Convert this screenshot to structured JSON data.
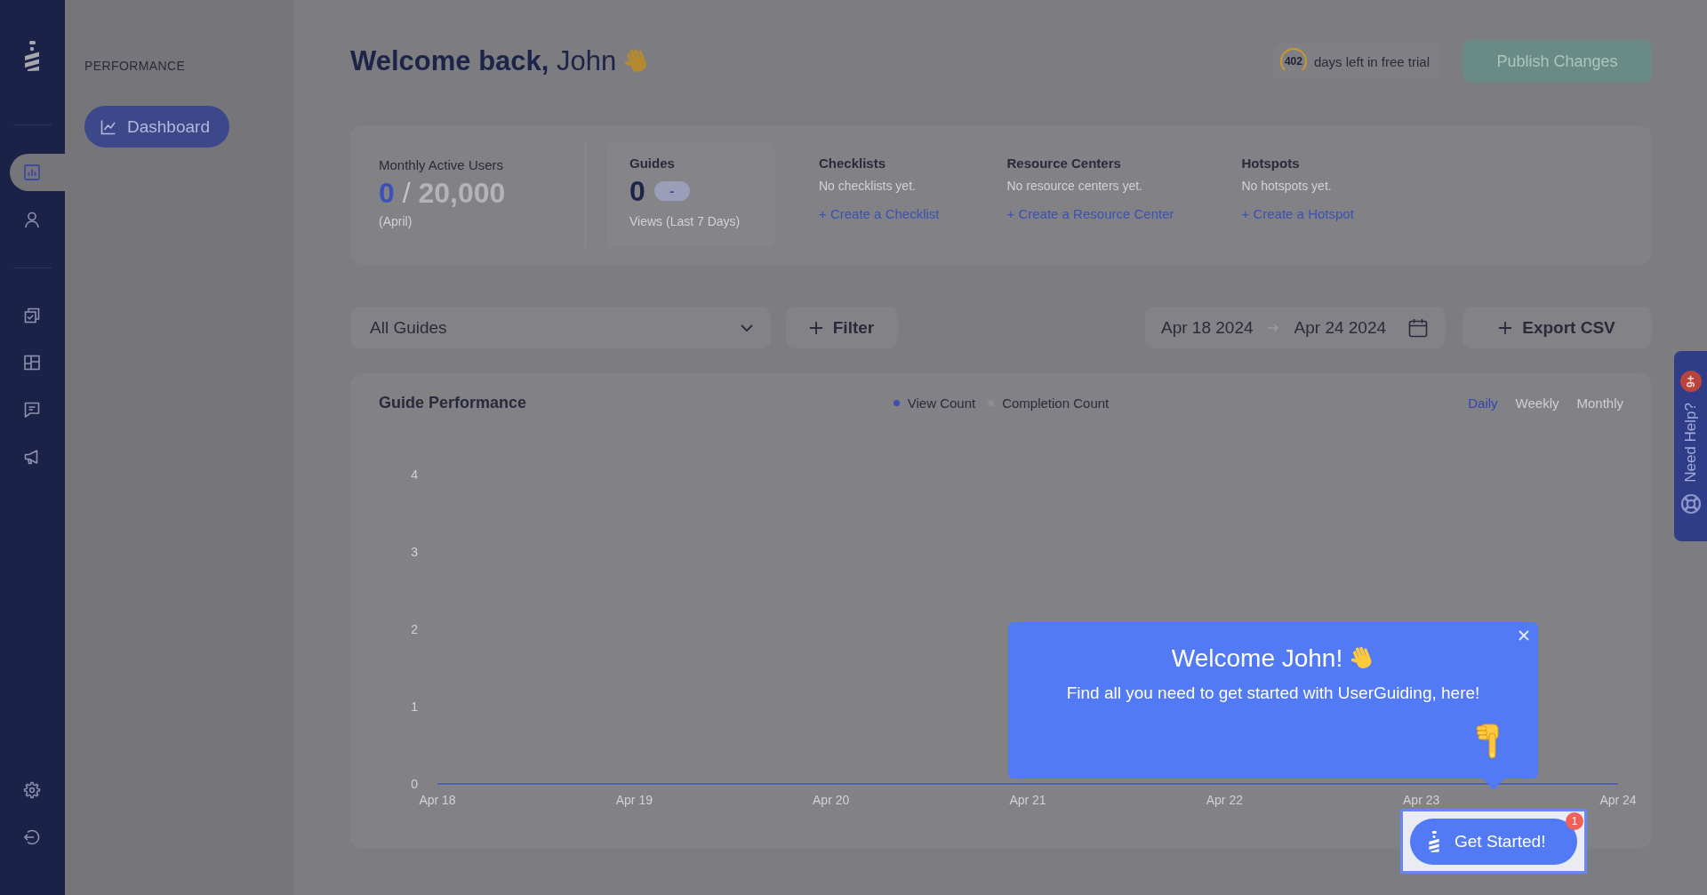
{
  "nav_rail": {
    "sections": [
      {
        "items": [
          {
            "kind": "chart",
            "selected": true
          },
          {
            "kind": "person",
            "selected": false
          }
        ]
      },
      {
        "items": [
          {
            "kind": "checklist",
            "selected": false
          },
          {
            "kind": "layout",
            "selected": false
          },
          {
            "kind": "chat",
            "selected": false
          },
          {
            "kind": "megaphone",
            "selected": false
          }
        ]
      },
      {
        "items": [
          {
            "kind": "gear",
            "selected": false
          },
          {
            "kind": "exit",
            "selected": false
          }
        ]
      }
    ]
  },
  "panel": {
    "heading": "PERFORMANCE",
    "items": [
      {
        "label": "Dashboard",
        "selected": true
      }
    ]
  },
  "header": {
    "title": "**Welcome back,** John",
    "trial": {
      "count": "402",
      "label": "days left in free trial"
    },
    "publish_button": {
      "label": "Publish Changes",
      "disabled": true
    }
  },
  "stats": {
    "monthly_active_users": {
      "label": "Monthly Active Users",
      "used": "0",
      "separator": "/",
      "limit": "20,000",
      "period": "(April)"
    },
    "guides": {
      "label": "Guides",
      "count": "0",
      "change": "-",
      "caption": "Views (Last 7 Days)"
    },
    "features": [
      {
        "title": "Checklists",
        "empty_text": "No checklists yet.",
        "link": "+ Create a Checklist"
      },
      {
        "title": "Resource Centers",
        "empty_text": "No resource centers yet.",
        "link": "+ Create a Resource Center"
      },
      {
        "title": "Hotspots",
        "empty_text": "No hotspots yet.",
        "link": "+ Create a Hotspot"
      }
    ]
  },
  "filters": {
    "guide_select": {
      "value": "All Guides"
    },
    "filter_button": {
      "label": "Filter"
    },
    "date_range": {
      "start": "Apr 18 2024",
      "end": "Apr 24 2024"
    },
    "export_button": {
      "label": "Export CSV"
    }
  },
  "chart_card": {
    "title": "Guide Performance",
    "periods": [
      {
        "label": "Daily",
        "selected": true
      },
      {
        "label": "Weekly",
        "selected": false
      },
      {
        "label": "Monthly",
        "selected": false
      }
    ],
    "chart_data": {
      "type": "line",
      "categories": [
        "Apr 18",
        "Apr 19",
        "Apr 20",
        "Apr 21",
        "Apr 22",
        "Apr 23",
        "Apr 24"
      ],
      "series": [
        {
          "name": "View Count",
          "color": "#3b4fb5",
          "values": [
            0,
            0,
            0,
            0,
            0,
            0,
            0
          ]
        },
        {
          "name": "Completion Count",
          "color": "#8e8d93",
          "values": [
            0,
            0,
            0,
            0,
            0,
            0,
            0
          ]
        }
      ],
      "ylim": [
        0,
        4
      ],
      "yticks": [
        0,
        1,
        2,
        3,
        4
      ]
    }
  },
  "welcome_popup": {
    "title": "Welcome John!",
    "body": "Find all you need to get started with UserGuiding, here!"
  },
  "launcher": {
    "label": "Get Started!",
    "badge": "1"
  },
  "help_tab": {
    "label": "Need Help?",
    "badge": "9+"
  }
}
